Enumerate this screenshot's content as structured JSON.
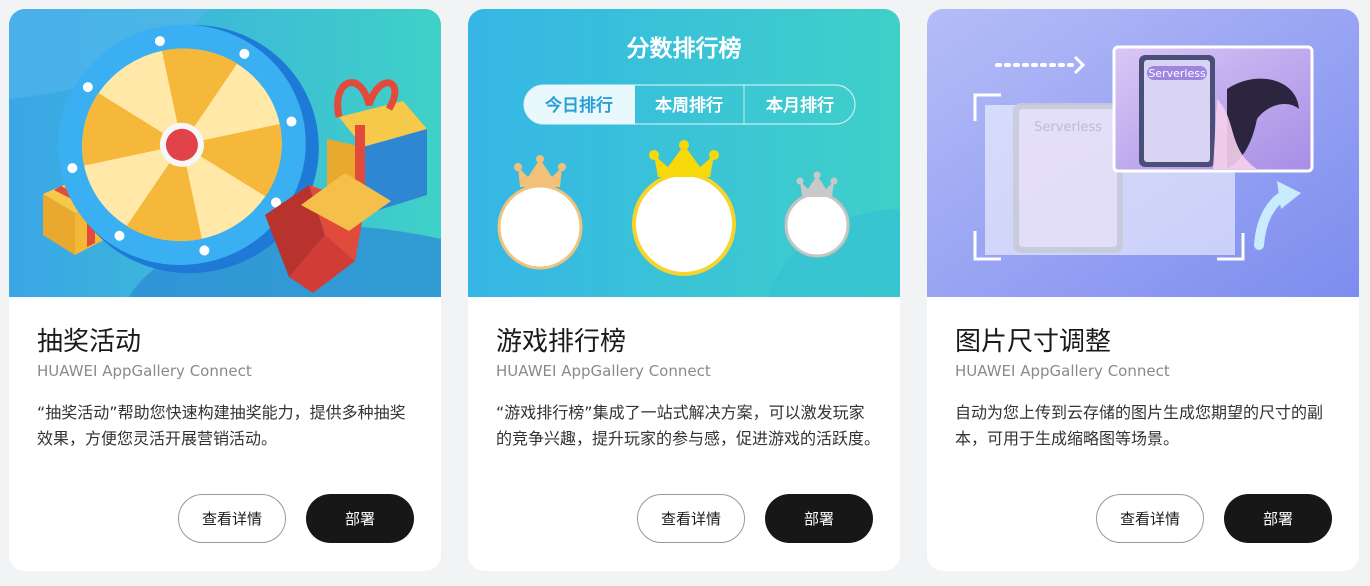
{
  "cards": [
    {
      "title": "抽奖活动",
      "subtitle": "HUAWEI AppGallery Connect",
      "description": "“抽奖活动”帮助您快速构建抽奖能力，提供多种抽奖效果，方便您灵活开展营销活动。",
      "detail_label": "查看详情",
      "deploy_label": "部署",
      "banner": {
        "illustration": "prize-wheel-and-gift-boxes",
        "colors": {
          "bg_left": "#3aa6e6",
          "bg_right": "#3fd1c7"
        }
      }
    },
    {
      "title": "游戏排行榜",
      "subtitle": "HUAWEI AppGallery Connect",
      "description": "“游戏排行榜”集成了一站式解决方案，可以激发玩家的竞争兴趣，提升玩家的参与感，促进游戏的活跃度。",
      "detail_label": "查看详情",
      "deploy_label": "部署",
      "banner": {
        "heading": "分数排行榜",
        "tabs": [
          "今日排行",
          "本周排行",
          "本月排行"
        ],
        "active_tab": "今日排行",
        "illustration": "podium-crowns-gold-silver-bronze",
        "colors": {
          "bg_left": "#35b6e6",
          "bg_right": "#3fd0c8"
        }
      }
    },
    {
      "title": "图片尺寸调整",
      "subtitle": "HUAWEI AppGallery Connect",
      "description": "自动为您上传到云存储的图片生成您期望的尺寸的副本，可用于生成缩略图等场景。",
      "detail_label": "查看详情",
      "deploy_label": "部署",
      "banner": {
        "image_label": "Serverless",
        "illustration": "image-resize-tablets",
        "colors": {
          "bg_left": "#a9b2f5",
          "bg_right": "#7f8ff0"
        }
      }
    }
  ],
  "colors": {
    "page_bg": "#f1f3f5",
    "card_bg": "#ffffff",
    "deploy_bg": "#171717",
    "title_text": "#1a1a1a",
    "subtitle_text": "#8a8a8a"
  }
}
